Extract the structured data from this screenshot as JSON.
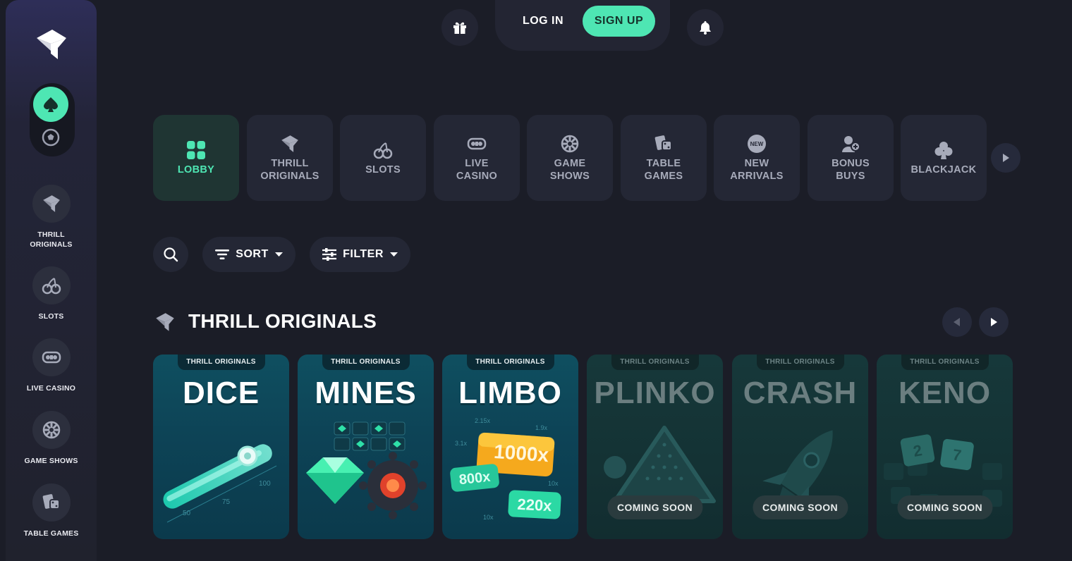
{
  "colors": {
    "accent": "#4ee6b3",
    "background": "#1b1d27",
    "panel": "#242735"
  },
  "header": {
    "login_label": "LOG IN",
    "signup_label": "SIGN UP",
    "gift_icon": "gift-icon",
    "bell_icon": "bell-icon"
  },
  "sidebar": {
    "logo_icon": "thrill-logo-icon",
    "toggle": {
      "active": "casino-spade-icon",
      "inactive": "sports-ball-icon"
    },
    "items": [
      {
        "label": "THRILL ORIGINALS",
        "icon": "thrill-icon"
      },
      {
        "label": "SLOTS",
        "icon": "cherry-icon"
      },
      {
        "label": "LIVE CASINO",
        "icon": "live-casino-icon"
      },
      {
        "label": "GAME SHOWS",
        "icon": "wheel-icon"
      },
      {
        "label": "TABLE GAMES",
        "icon": "dice-cards-icon"
      }
    ]
  },
  "categories": [
    {
      "label": "LOBBY",
      "icon": "grid-icon",
      "active": true
    },
    {
      "label": "THRILL ORIGINALS",
      "icon": "thrill-icon"
    },
    {
      "label": "SLOTS",
      "icon": "cherry-icon"
    },
    {
      "label": "LIVE CASINO",
      "icon": "live-casino-icon"
    },
    {
      "label": "GAME SHOWS",
      "icon": "wheel-icon"
    },
    {
      "label": "TABLE GAMES",
      "icon": "dice-cards-icon"
    },
    {
      "label": "NEW ARRIVALS",
      "icon": "new-badge-icon"
    },
    {
      "label": "BONUS BUYS",
      "icon": "bonus-buys-icon"
    },
    {
      "label": "BLACKJACK",
      "icon": "club-icon"
    }
  ],
  "toolbar": {
    "sort_label": "SORT",
    "filter_label": "FILTER"
  },
  "section": {
    "title": "THRILL ORIGINALS"
  },
  "games": [
    {
      "title": "DICE",
      "tag": "THRILL ORIGINALS",
      "status": "live"
    },
    {
      "title": "MINES",
      "tag": "THRILL ORIGINALS",
      "status": "live"
    },
    {
      "title": "LIMBO",
      "tag": "THRILL ORIGINALS",
      "status": "live",
      "multipliers": [
        "1000x",
        "800x",
        "220x",
        "2.15x",
        "1.9x",
        "3.1x",
        "10x",
        "10x"
      ]
    },
    {
      "title": "PLINKO",
      "tag": "THRILL ORIGINALS",
      "status": "soon",
      "badge": "COMING SOON"
    },
    {
      "title": "CRASH",
      "tag": "THRILL ORIGINALS",
      "status": "soon",
      "badge": "COMING SOON"
    },
    {
      "title": "KENO",
      "tag": "THRILL ORIGINALS",
      "status": "soon",
      "badge": "COMING SOON"
    }
  ],
  "dice_scale": [
    "50",
    "75",
    "100"
  ],
  "keno_numbers": [
    "2",
    "7"
  ]
}
